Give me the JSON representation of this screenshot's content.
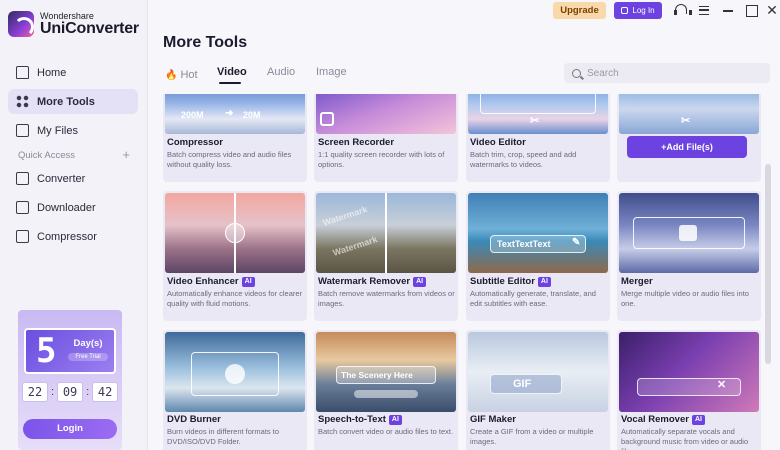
{
  "brand": {
    "line1": "Wondershare",
    "line2": "UniConverter"
  },
  "sidebar": {
    "items": [
      {
        "label": "Home",
        "icon": "home-icon"
      },
      {
        "label": "More Tools",
        "icon": "tools-grid-icon",
        "active": true
      },
      {
        "label": "My Files",
        "icon": "file-icon"
      }
    ],
    "quick_access_label": "Quick Access",
    "quick_access_plus": "+",
    "quick_items": [
      {
        "label": "Converter",
        "icon": "converter-icon"
      },
      {
        "label": "Downloader",
        "icon": "download-icon"
      },
      {
        "label": "Compressor",
        "icon": "compress-icon"
      }
    ]
  },
  "promo": {
    "days_number": "5",
    "days_label": "Day(s)",
    "trial_label": "Free Trial",
    "timer": {
      "h": "22",
      "m": "09",
      "s": "42",
      "sep": ":"
    },
    "login_label": "Login"
  },
  "topbar": {
    "upgrade_label": "Upgrade",
    "login_label": "Log In"
  },
  "page": {
    "title": "More Tools"
  },
  "tabs": {
    "hot": "Hot",
    "video": "Video",
    "audio": "Audio",
    "image": "Image",
    "active": "Video"
  },
  "search": {
    "placeholder": "Search",
    "value": ""
  },
  "colors": {
    "accent": "#6c43e0",
    "upgrade_bg": "#f9d9a9",
    "sidebar_active": "#e4e0f6"
  },
  "cards": {
    "compressor": {
      "title": "Compressor",
      "desc": "Batch compress video and audio files without quality loss.",
      "overlay_from": "200M",
      "overlay_to": "20M"
    },
    "screen_recorder": {
      "title": "Screen Recorder",
      "desc": "1:1 quality screen recorder with lots of options."
    },
    "video_editor": {
      "title": "Video Editor",
      "desc": "Batch trim, crop, speed and add watermarks to videos."
    },
    "add_files": {
      "label": "Add File(s)",
      "plus": "+"
    },
    "video_enhancer": {
      "title": "Video Enhancer",
      "ai": "AI",
      "desc": "Automatically enhance videos for clearer quality with fluid motions."
    },
    "watermark_remover": {
      "title": "Watermark Remover",
      "ai": "AI",
      "desc": "Batch remove watermarks from videos or images.",
      "overlay": "Watermark"
    },
    "subtitle_editor": {
      "title": "Subtitle Editor",
      "ai": "AI",
      "desc": "Automatically generate, translate, and edit subtitles with ease.",
      "overlay": "TextTextText"
    },
    "merger": {
      "title": "Merger",
      "desc": "Merge multiple video or audio files into one."
    },
    "dvd_burner": {
      "title": "DVD Burner",
      "desc": "Burn videos in different formats to DVD/ISO/DVD Folder."
    },
    "speech_to_text": {
      "title": "Speech-to-Text",
      "ai": "AI",
      "desc": "Batch convert video or audio files to text.",
      "overlay": "The Scenery Here"
    },
    "gif_maker": {
      "title": "GIF Maker",
      "desc": "Create a GIF from a video or multiple images.",
      "overlay": "GIF"
    },
    "vocal_remover": {
      "title": "Vocal Remover",
      "ai": "AI",
      "desc": "Automatically separate vocals and background music from video or audio files"
    }
  }
}
